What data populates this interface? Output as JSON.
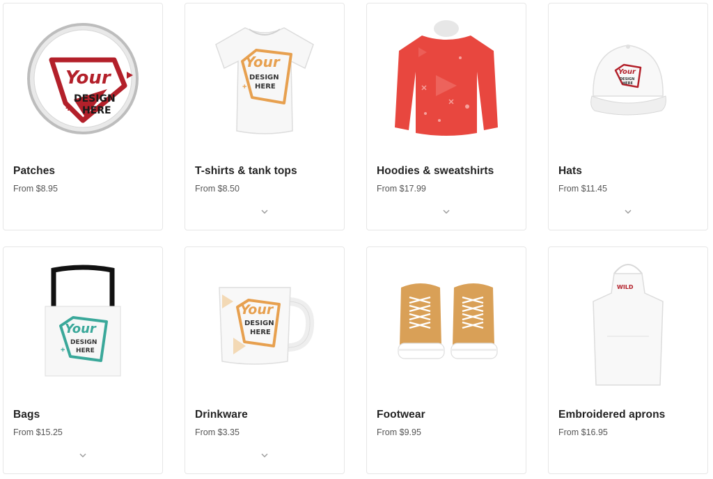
{
  "products": [
    {
      "name": "Patches",
      "price": "From $8.95",
      "has_chevron": false,
      "icon": "embroidered-patch-image",
      "print": {
        "your": "Your",
        "design": "DESIGN",
        "here": "HERE"
      }
    },
    {
      "name": "T-shirts & tank tops",
      "price": "From $8.50",
      "has_chevron": true,
      "icon": "tshirt-image",
      "print": {
        "your": "Your",
        "design": "DESIGN",
        "here": "HERE"
      }
    },
    {
      "name": "Hoodies & sweatshirts",
      "price": "From $17.99",
      "has_chevron": true,
      "icon": "sweatshirt-image"
    },
    {
      "name": "Hats",
      "price": "From $11.45",
      "has_chevron": true,
      "icon": "cap-image",
      "print": {
        "your": "Your",
        "design": "DESIGN",
        "here": "HERE"
      }
    },
    {
      "name": "Bags",
      "price": "From $15.25",
      "has_chevron": true,
      "icon": "tote-bag-image",
      "print": {
        "your": "Your",
        "design": "DESIGN",
        "here": "HERE"
      }
    },
    {
      "name": "Drinkware",
      "price": "From $3.35",
      "has_chevron": true,
      "icon": "mug-image",
      "print": {
        "your": "Your",
        "design": "DESIGN",
        "here": "HERE"
      }
    },
    {
      "name": "Footwear",
      "price": "From $9.95",
      "has_chevron": false,
      "icon": "sneakers-image"
    },
    {
      "name": "Embroidered aprons",
      "price": "From $16.95",
      "has_chevron": false,
      "icon": "apron-image",
      "print": {
        "logo": "WILD"
      }
    }
  ],
  "colors": {
    "patch_red": "#b3202a",
    "tee_orange": "#e7a04f",
    "hoodie_red": "#e8473f",
    "bag_teal": "#3aa89a",
    "shoe_tan": "#d9a057"
  }
}
